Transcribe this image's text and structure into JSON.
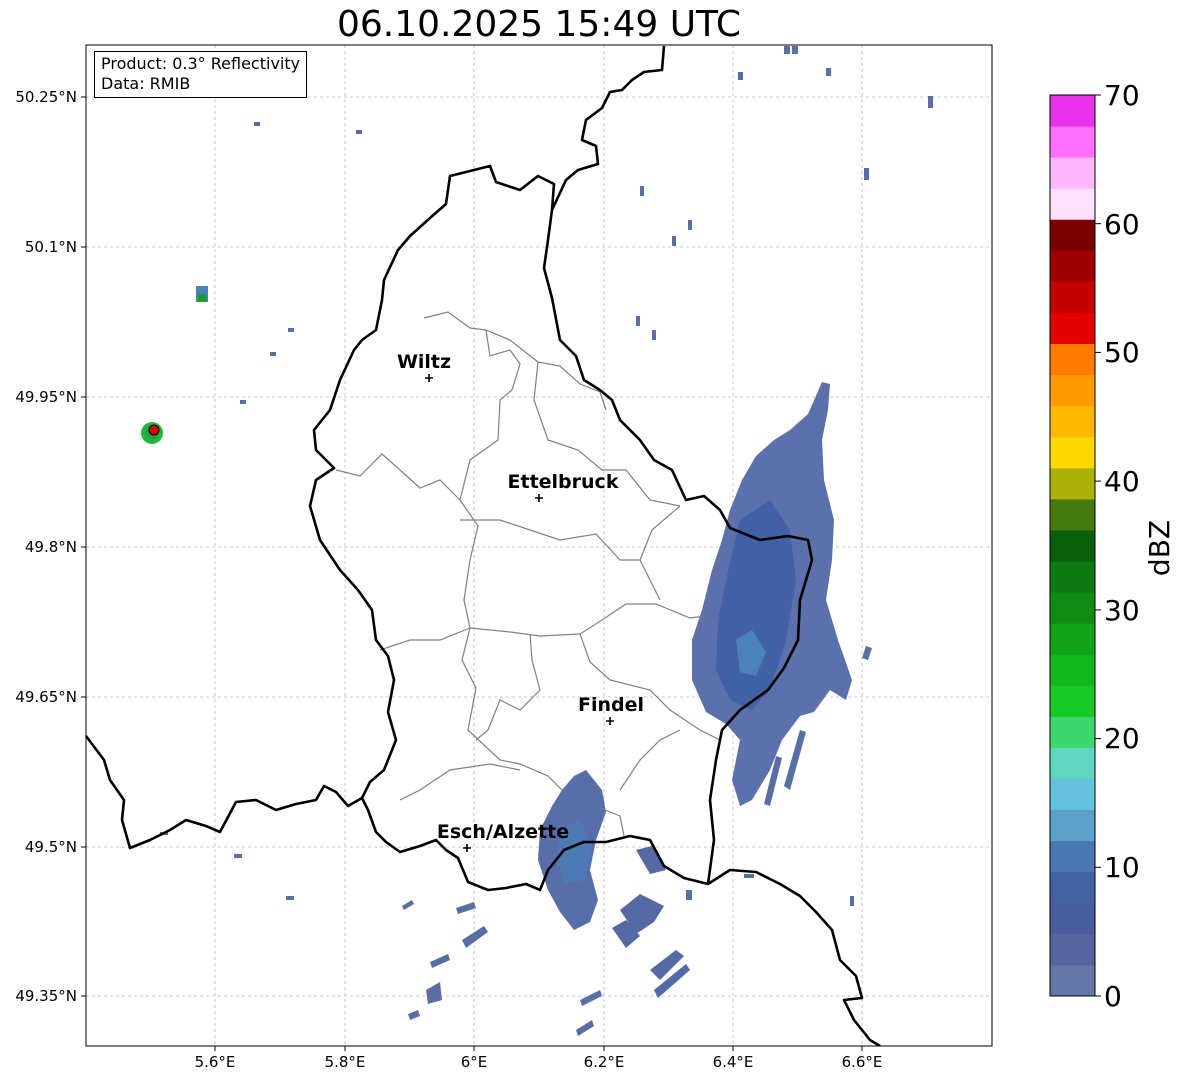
{
  "title": "06.10.2025 15:49 UTC",
  "info": {
    "product": "Product: 0.3° Reflectivity",
    "source": "Data: RMIB"
  },
  "map": {
    "lat_ticks": [
      "50.25°N",
      "50.1°N",
      "49.95°N",
      "49.8°N",
      "49.65°N",
      "49.5°N",
      "49.35°N"
    ],
    "lon_ticks": [
      "5.6°E",
      "5.8°E",
      "6°E",
      "6.2°E",
      "6.4°E",
      "6.6°E"
    ],
    "cities": [
      {
        "name": "Wiltz"
      },
      {
        "name": "Ettelbruck"
      },
      {
        "name": "Findel"
      },
      {
        "name": "Esch/Alzette"
      }
    ],
    "radar_site_color": "#e00000"
  },
  "colorbar": {
    "label": "dBZ",
    "ticks": [
      "0",
      "10",
      "20",
      "30",
      "40",
      "50",
      "60",
      "70"
    ],
    "colors": [
      "#6577a6",
      "#5665a0",
      "#4a5d9e",
      "#4362a2",
      "#4a78b2",
      "#5aa0c8",
      "#66c2dc",
      "#60d6c0",
      "#3fd670",
      "#18c826",
      "#10b81c",
      "#12a418",
      "#108c14",
      "#0e7a12",
      "#0a5e0c",
      "#467a0c",
      "#aeb208",
      "#ffd800",
      "#ffb800",
      "#ff9a00",
      "#ff7c00",
      "#e40000",
      "#c40000",
      "#a00000",
      "#7a0000",
      "#ffe0ff",
      "#ffb8ff",
      "#ff70ff",
      "#ea32ea"
    ]
  }
}
